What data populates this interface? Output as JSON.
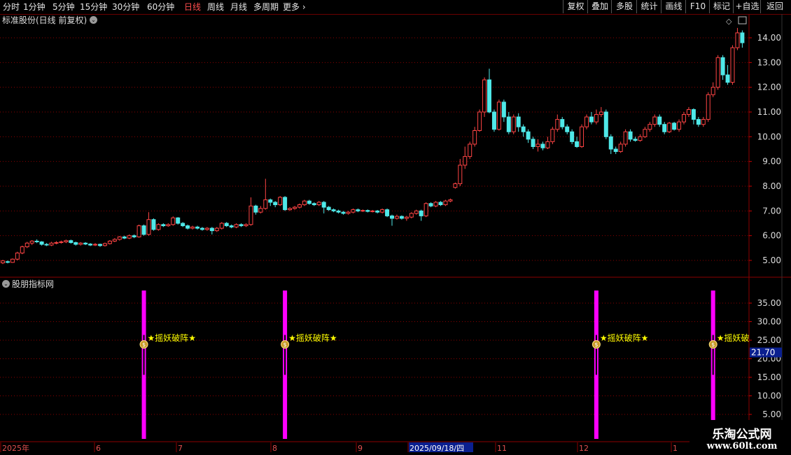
{
  "toolbar": {
    "periods": [
      "分时",
      "1分钟",
      "5分钟",
      "15分钟",
      "30分钟",
      "60分钟",
      "日线",
      "周线",
      "月线",
      "多周期",
      "更多"
    ],
    "active_period": "日线",
    "buttons": [
      "复权",
      "叠加",
      "多股",
      "统计",
      "画线",
      "F10",
      "标记",
      "+自选",
      "返回"
    ]
  },
  "main_chart": {
    "title": "标准股份(日线 前复权)",
    "y_ticks": [
      "14.00",
      "13.00",
      "12.00",
      "11.00",
      "10.00",
      "9.00",
      "8.00",
      "7.00",
      "6.00",
      "5.00"
    ]
  },
  "indicator": {
    "title": "股朋指标网",
    "y_ticks": [
      "35.00",
      "30.00",
      "25.00",
      "20.00",
      "15.00",
      "10.00",
      "5.00"
    ],
    "current_value": "21.70",
    "signal_label": "★摇妖破阵★",
    "signal_label_truncated": "★摇妖破"
  },
  "time_axis": {
    "labels": [
      "2025年",
      "6",
      "7",
      "8",
      "9",
      "2025/09/18/四",
      "11",
      "12",
      "1"
    ]
  },
  "watermark": {
    "name": "乐淘公式网",
    "url": "www.60lt.com"
  },
  "colors": {
    "up": "#ff4444",
    "down": "#4fe8e8",
    "signal": "#ff00ff",
    "label": "#ffff00",
    "grid": "#8b0000"
  },
  "chart_data": {
    "type": "candlestick",
    "ylim": [
      4.7,
      14.5
    ],
    "candles": [
      [
        4.9,
        4.98,
        4.85,
        5.02
      ],
      [
        4.95,
        4.92,
        4.88,
        5.0
      ],
      [
        4.92,
        5.05,
        4.9,
        5.08
      ],
      [
        5.05,
        5.3,
        5.0,
        5.35
      ],
      [
        5.3,
        5.55,
        5.25,
        5.6
      ],
      [
        5.55,
        5.7,
        5.5,
        5.75
      ],
      [
        5.7,
        5.78,
        5.62,
        5.82
      ],
      [
        5.78,
        5.75,
        5.7,
        5.85
      ],
      [
        5.75,
        5.65,
        5.6,
        5.78
      ],
      [
        5.65,
        5.62,
        5.58,
        5.7
      ],
      [
        5.62,
        5.7,
        5.58,
        5.75
      ],
      [
        5.7,
        5.72,
        5.65,
        5.78
      ],
      [
        5.72,
        5.75,
        5.68,
        5.8
      ],
      [
        5.75,
        5.8,
        5.7,
        5.84
      ],
      [
        5.8,
        5.72,
        5.68,
        5.84
      ],
      [
        5.72,
        5.65,
        5.6,
        5.76
      ],
      [
        5.65,
        5.7,
        5.6,
        5.74
      ],
      [
        5.7,
        5.66,
        5.62,
        5.74
      ],
      [
        5.66,
        5.62,
        5.58,
        5.7
      ],
      [
        5.62,
        5.65,
        5.58,
        5.7
      ],
      [
        5.65,
        5.6,
        5.55,
        5.68
      ],
      [
        5.6,
        5.68,
        5.56,
        5.72
      ],
      [
        5.68,
        5.78,
        5.64,
        5.82
      ],
      [
        5.78,
        5.85,
        5.74,
        5.9
      ],
      [
        5.85,
        5.95,
        5.8,
        5.98
      ],
      [
        5.95,
        5.9,
        5.86,
        6.0
      ],
      [
        5.9,
        6.0,
        5.86,
        6.05
      ],
      [
        6.0,
        5.95,
        5.9,
        6.05
      ],
      [
        5.95,
        6.4,
        5.92,
        6.45
      ],
      [
        6.4,
        6.05,
        6.0,
        6.45
      ],
      [
        6.05,
        6.65,
        6.0,
        6.95
      ],
      [
        6.65,
        6.25,
        6.2,
        6.7
      ],
      [
        6.25,
        6.45,
        6.2,
        6.5
      ],
      [
        6.45,
        6.4,
        6.35,
        6.5
      ],
      [
        6.4,
        6.45,
        6.36,
        6.5
      ],
      [
        6.45,
        6.72,
        6.4,
        6.78
      ],
      [
        6.72,
        6.5,
        6.45,
        6.75
      ],
      [
        6.5,
        6.4,
        6.35,
        6.55
      ],
      [
        6.4,
        6.3,
        6.25,
        6.45
      ],
      [
        6.3,
        6.35,
        6.25,
        6.4
      ],
      [
        6.35,
        6.3,
        6.25,
        6.4
      ],
      [
        6.3,
        6.25,
        6.2,
        6.35
      ],
      [
        6.25,
        6.3,
        6.2,
        6.35
      ],
      [
        6.3,
        6.2,
        6.05,
        6.35
      ],
      [
        6.2,
        6.3,
        6.15,
        6.35
      ],
      [
        6.3,
        6.5,
        6.25,
        6.55
      ],
      [
        6.5,
        6.4,
        6.35,
        6.55
      ],
      [
        6.4,
        6.35,
        6.3,
        6.45
      ],
      [
        6.35,
        6.45,
        6.3,
        6.5
      ],
      [
        6.45,
        6.4,
        6.35,
        6.5
      ],
      [
        6.4,
        6.45,
        6.35,
        6.5
      ],
      [
        6.45,
        7.2,
        6.4,
        7.55
      ],
      [
        7.2,
        6.95,
        6.85,
        7.25
      ],
      [
        6.95,
        7.1,
        6.9,
        7.2
      ],
      [
        7.1,
        7.45,
        7.05,
        8.3
      ],
      [
        7.45,
        7.35,
        7.2,
        7.5
      ],
      [
        7.35,
        7.25,
        7.15,
        7.4
      ],
      [
        7.25,
        7.55,
        7.2,
        7.6
      ],
      [
        7.55,
        7.05,
        7.0,
        7.6
      ],
      [
        7.05,
        7.1,
        7.0,
        7.15
      ],
      [
        7.1,
        7.15,
        7.05,
        7.2
      ],
      [
        7.15,
        7.25,
        7.1,
        7.3
      ],
      [
        7.25,
        7.4,
        7.2,
        7.45
      ],
      [
        7.4,
        7.3,
        7.25,
        7.45
      ],
      [
        7.3,
        7.25,
        7.2,
        7.35
      ],
      [
        7.25,
        7.35,
        7.2,
        7.4
      ],
      [
        7.35,
        7.15,
        6.9,
        7.4
      ],
      [
        7.15,
        7.05,
        7.0,
        7.2
      ],
      [
        7.05,
        7.0,
        6.95,
        7.1
      ],
      [
        7.0,
        6.95,
        6.9,
        7.05
      ],
      [
        6.95,
        6.9,
        6.85,
        7.0
      ],
      [
        6.9,
        6.95,
        6.85,
        7.0
      ],
      [
        6.95,
        7.05,
        6.9,
        7.1
      ],
      [
        7.05,
        7.0,
        6.95,
        7.1
      ],
      [
        7.0,
        7.02,
        6.96,
        7.06
      ],
      [
        7.02,
        6.98,
        6.94,
        7.06
      ],
      [
        6.98,
        7.0,
        6.94,
        7.04
      ],
      [
        7.0,
        6.95,
        6.9,
        7.04
      ],
      [
        6.95,
        7.05,
        6.9,
        7.1
      ],
      [
        7.05,
        6.8,
        6.75,
        7.1
      ],
      [
        6.8,
        6.7,
        6.4,
        6.85
      ],
      [
        6.7,
        6.78,
        6.65,
        6.85
      ],
      [
        6.78,
        6.7,
        6.65,
        6.82
      ],
      [
        6.7,
        6.75,
        6.6,
        6.8
      ],
      [
        6.75,
        6.9,
        6.7,
        6.95
      ],
      [
        6.9,
        7.0,
        6.85,
        7.05
      ],
      [
        7.0,
        6.8,
        6.6,
        7.05
      ],
      [
        6.8,
        7.3,
        6.75,
        7.35
      ],
      [
        7.3,
        7.2,
        7.15,
        7.35
      ],
      [
        7.2,
        7.35,
        7.15,
        7.4
      ],
      [
        7.35,
        7.25,
        7.2,
        7.4
      ],
      [
        7.25,
        7.4,
        7.2,
        7.45
      ],
      [
        7.4,
        7.45,
        7.35,
        7.5
      ],
      [
        7.95,
        8.1,
        7.9,
        8.15
      ],
      [
        8.1,
        8.85,
        8.0,
        9.1
      ],
      [
        8.85,
        9.2,
        8.7,
        9.6
      ],
      [
        9.2,
        9.7,
        9.1,
        9.8
      ],
      [
        9.7,
        10.25,
        9.6,
        10.4
      ],
      [
        10.25,
        11.0,
        10.2,
        11.1
      ],
      [
        11.0,
        12.3,
        10.8,
        12.4
      ],
      [
        12.3,
        11.0,
        10.95,
        12.75
      ],
      [
        11.0,
        10.3,
        10.2,
        11.1
      ],
      [
        10.3,
        11.4,
        10.25,
        11.5
      ],
      [
        11.4,
        10.8,
        10.6,
        11.5
      ],
      [
        10.8,
        10.2,
        10.1,
        11.0
      ],
      [
        10.2,
        10.8,
        10.1,
        10.9
      ],
      [
        10.8,
        10.4,
        10.2,
        10.95
      ],
      [
        10.4,
        10.2,
        10.0,
        10.5
      ],
      [
        10.2,
        9.9,
        9.75,
        10.3
      ],
      [
        9.9,
        9.6,
        9.5,
        10.0
      ],
      [
        9.6,
        9.7,
        9.4,
        9.9
      ],
      [
        9.7,
        9.55,
        9.45,
        9.8
      ],
      [
        9.55,
        9.8,
        9.5,
        10.0
      ],
      [
        9.8,
        10.3,
        9.7,
        10.4
      ],
      [
        10.3,
        10.7,
        10.2,
        10.9
      ],
      [
        10.7,
        10.4,
        10.3,
        10.8
      ],
      [
        10.4,
        10.2,
        10.1,
        10.5
      ],
      [
        10.2,
        9.8,
        9.7,
        10.3
      ],
      [
        9.8,
        9.6,
        9.55,
        10.0
      ],
      [
        9.6,
        10.4,
        9.55,
        10.5
      ],
      [
        10.4,
        10.8,
        10.3,
        10.9
      ],
      [
        10.8,
        10.6,
        10.5,
        11.0
      ],
      [
        10.6,
        10.9,
        10.5,
        11.1
      ],
      [
        10.9,
        11.0,
        10.8,
        11.2
      ],
      [
        11.0,
        10.0,
        9.9,
        11.1
      ],
      [
        10.0,
        9.5,
        9.3,
        10.1
      ],
      [
        9.5,
        9.4,
        9.3,
        9.6
      ],
      [
        9.4,
        9.7,
        9.35,
        9.8
      ],
      [
        9.7,
        10.2,
        9.6,
        10.3
      ],
      [
        10.2,
        9.9,
        9.8,
        10.3
      ],
      [
        9.9,
        9.85,
        9.8,
        10.0
      ],
      [
        9.85,
        10.0,
        9.8,
        10.1
      ],
      [
        10.0,
        10.3,
        9.95,
        10.4
      ],
      [
        10.3,
        10.5,
        10.2,
        10.6
      ],
      [
        10.5,
        10.8,
        10.4,
        10.9
      ],
      [
        10.8,
        10.5,
        10.4,
        10.9
      ],
      [
        10.5,
        10.2,
        10.1,
        10.6
      ],
      [
        10.2,
        10.55,
        10.15,
        10.6
      ],
      [
        10.55,
        10.3,
        10.25,
        10.6
      ],
      [
        10.3,
        10.6,
        10.2,
        10.7
      ],
      [
        10.6,
        10.9,
        10.5,
        11.0
      ],
      [
        10.9,
        11.1,
        10.8,
        11.2
      ],
      [
        11.1,
        10.7,
        10.5,
        11.15
      ],
      [
        10.7,
        10.5,
        10.4,
        10.8
      ],
      [
        10.5,
        10.7,
        10.4,
        10.8
      ],
      [
        10.7,
        11.7,
        10.6,
        11.8
      ],
      [
        11.7,
        12.0,
        11.6,
        12.2
      ],
      [
        12.0,
        13.2,
        11.9,
        13.3
      ],
      [
        13.2,
        12.5,
        12.3,
        13.3
      ],
      [
        12.5,
        12.2,
        12.1,
        12.9
      ],
      [
        12.2,
        13.6,
        12.1,
        13.7
      ],
      [
        13.6,
        14.2,
        13.5,
        14.4
      ],
      [
        14.2,
        13.8,
        13.6,
        14.3
      ]
    ],
    "signal_bars": [
      {
        "index": 29,
        "label": "★摇妖破阵★"
      },
      {
        "index": 58,
        "label": "★摇妖破阵★"
      },
      {
        "index": 122,
        "label": "★摇妖破阵★"
      },
      {
        "index": 146,
        "label": "★摇妖破"
      }
    ],
    "indicator_ylim": [
      5,
      38
    ]
  }
}
